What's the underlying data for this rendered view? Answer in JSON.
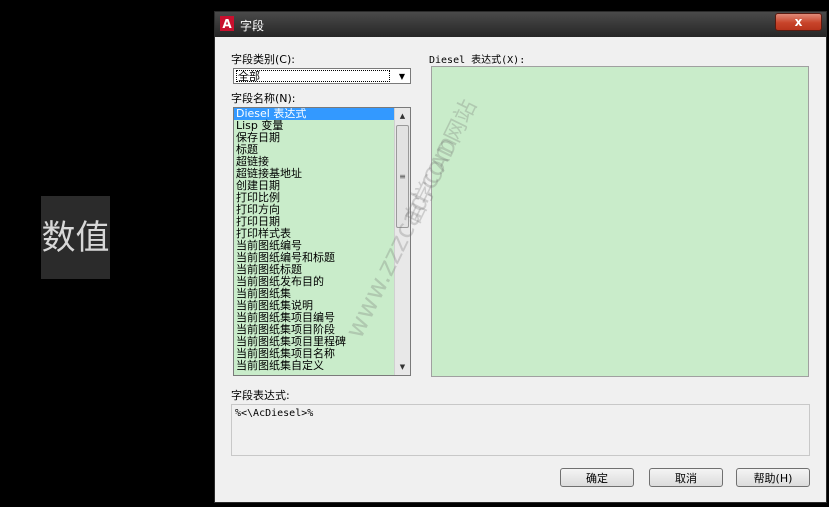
{
  "canvas": {
    "label": "数值"
  },
  "dialog": {
    "title": "字段",
    "close_glyph": "x",
    "category_label": "字段类别(C):",
    "category_value": "全部",
    "name_label": "字段名称(N):",
    "field_names": [
      "Diesel 表达式",
      "Lisp 变量",
      "保存日期",
      "标题",
      "超链接",
      "超链接基地址",
      "创建日期",
      "打印比例",
      "打印方向",
      "打印日期",
      "打印样式表",
      "当前图纸编号",
      "当前图纸编号和标题",
      "当前图纸标题",
      "当前图纸发布目的",
      "当前图纸集",
      "当前图纸集说明",
      "当前图纸集项目编号",
      "当前图纸集项目阶段",
      "当前图纸集项目里程碑",
      "当前图纸集项目名称",
      "当前图纸集自定义"
    ],
    "selected_index": 0,
    "diesel_label": "Diesel 表达式(X):",
    "field_expression_label": "字段表达式:",
    "field_expression_value": "%<\\AcDiesel>%",
    "ok_label": "确定",
    "cancel_label": "取消",
    "help_label": "帮助(H)"
  },
  "watermark": {
    "line1": "www.zzzcad.com",
    "line2": "自学CAD网站"
  }
}
